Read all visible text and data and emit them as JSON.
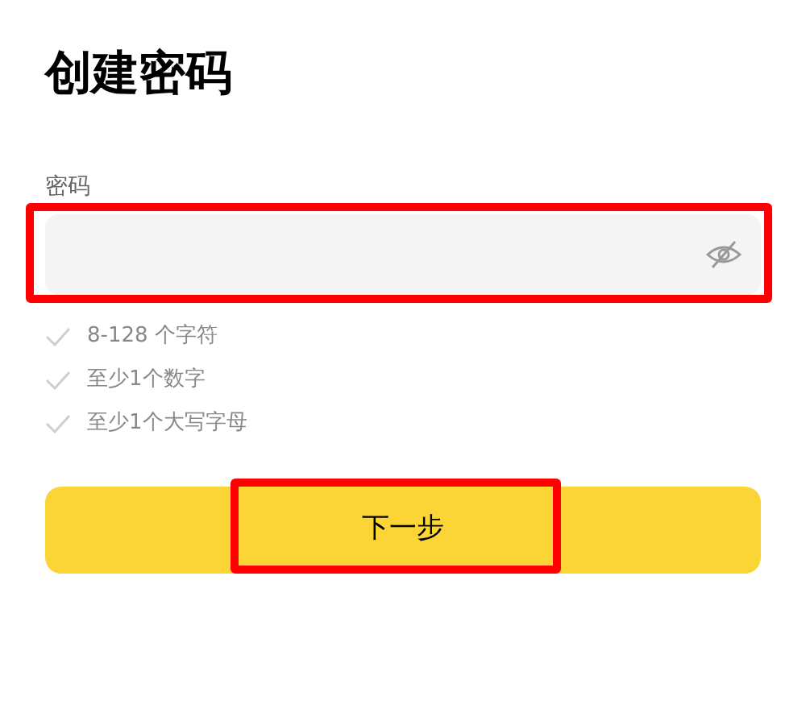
{
  "title": "创建密码",
  "password_field": {
    "label": "密码",
    "highlighted": true
  },
  "requirements": [
    {
      "text": "8-128 个字符",
      "met": false
    },
    {
      "text": "至少1个数字",
      "met": false
    },
    {
      "text": "至少1个大写字母",
      "met": false
    }
  ],
  "next_button": {
    "label": "下一步",
    "highlighted": true
  }
}
